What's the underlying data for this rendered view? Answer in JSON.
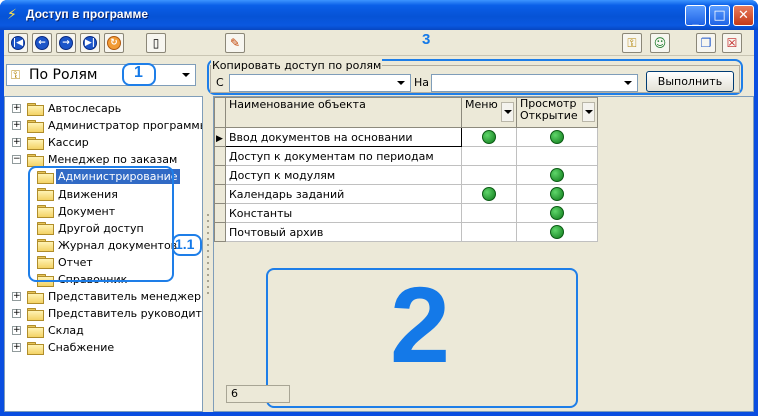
{
  "window": {
    "title": "Доступ в программе"
  },
  "toolbar": {
    "left_icons": [
      "first-icon",
      "back-icon",
      "forward-icon",
      "last-icon",
      "refresh-icon",
      "new-document-icon",
      "edit-icon"
    ],
    "right_icons": [
      "keys-icon",
      "users-icon",
      "copy-window-icon",
      "close-window-icon"
    ]
  },
  "role_select": {
    "value": "По Ролям"
  },
  "copy_access": {
    "legend": "Копировать доступ по ролям",
    "from_label": "С",
    "from_value": "",
    "to_label": "На",
    "to_value": "",
    "execute_label": "Выполнить"
  },
  "annotations": {
    "label_1": "1",
    "label_1_1": "1.1",
    "label_2": "2",
    "label_3": "3"
  },
  "tree": {
    "nodes": [
      {
        "label": "Автослесарь",
        "expander": "+"
      },
      {
        "label": "Администратор программы",
        "expander": "+"
      },
      {
        "label": "Кассир",
        "expander": "+"
      },
      {
        "label": "Менеджер по заказам",
        "expander": "−"
      },
      {
        "label": "Администрирование",
        "selected": true
      },
      {
        "label": "Движения"
      },
      {
        "label": "Документ"
      },
      {
        "label": "Другой доступ"
      },
      {
        "label": "Журнал документов"
      },
      {
        "label": "Отчет"
      },
      {
        "label": "Справочник"
      },
      {
        "label": "Представитель менеджер",
        "expander": "+"
      },
      {
        "label": "Представитель руководитель",
        "expander": "+"
      },
      {
        "label": "Склад",
        "expander": "+"
      },
      {
        "label": "Снабжение",
        "expander": "+"
      }
    ]
  },
  "grid": {
    "columns": [
      "Наименование объекта",
      "Меню",
      "Просмотр Открытие"
    ],
    "rows": [
      {
        "name": "Ввод документов на основании",
        "menu": true,
        "view": true
      },
      {
        "name": "Доступ к документам по периодам",
        "menu": false,
        "view": false
      },
      {
        "name": "Доступ к модулям",
        "menu": false,
        "view": true
      },
      {
        "name": "Календарь заданий",
        "menu": true,
        "view": true
      },
      {
        "name": "Константы",
        "menu": false,
        "view": true
      },
      {
        "name": "Почтовый архив",
        "menu": false,
        "view": true
      }
    ],
    "row_count": "6"
  }
}
